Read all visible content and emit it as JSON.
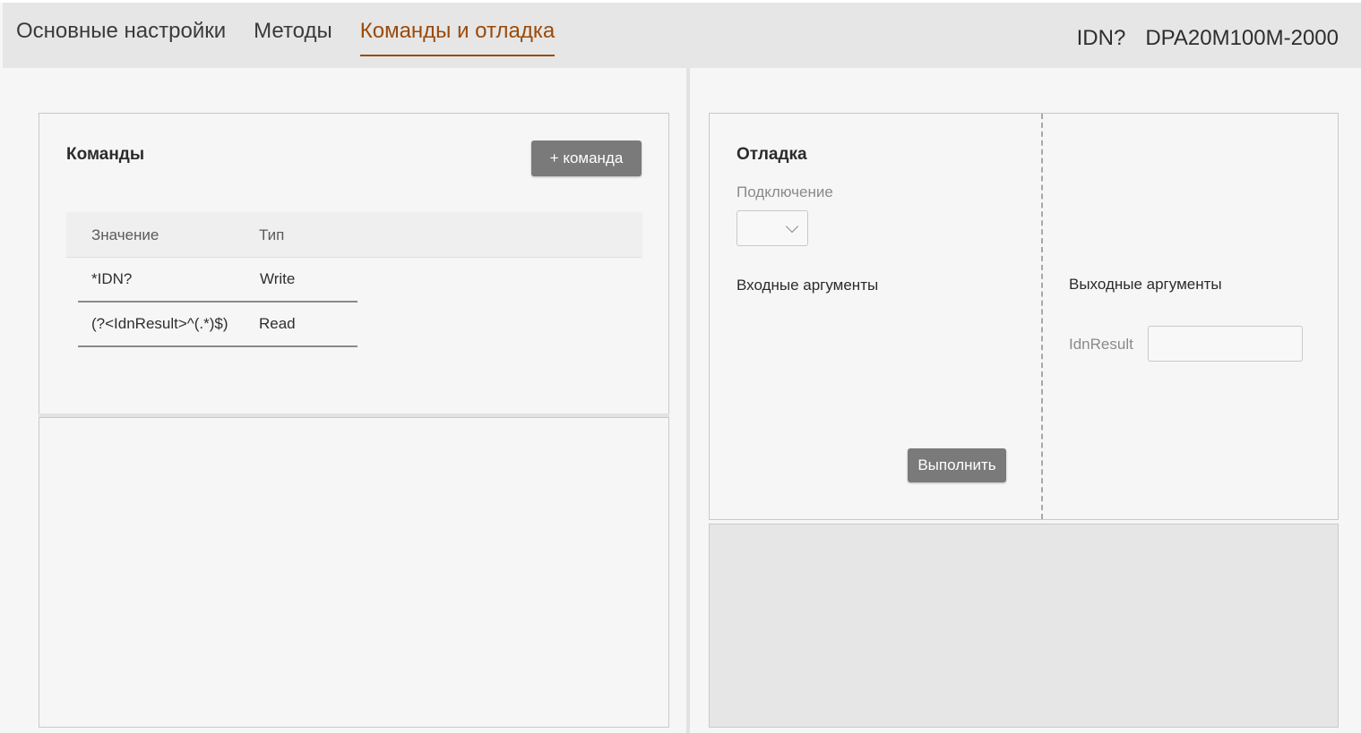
{
  "tabs": [
    {
      "label": "Основные настройки",
      "active": false
    },
    {
      "label": "Методы",
      "active": false
    },
    {
      "label": "Команды и отладка",
      "active": true
    }
  ],
  "device": {
    "idn_label": "IDN?",
    "model": "DPA20M100M-2000"
  },
  "commands": {
    "title": "Команды",
    "add_button": "+ команда",
    "columns": [
      "Значение",
      "Тип"
    ],
    "rows": [
      {
        "value": "*IDN?",
        "type": "Write"
      },
      {
        "value": "(?<IdnResult>^(.*)$)",
        "type": "Read"
      }
    ]
  },
  "debug": {
    "title": "Отладка",
    "connection_label": "Подключение",
    "connection_value": "",
    "input_args_label": "Входные аргументы",
    "output_args_label": "Выходные аргументы",
    "output_args": [
      {
        "name": "IdnResult",
        "value": ""
      }
    ],
    "run_button": "Выполнить"
  },
  "colors": {
    "accent": "#9a4a0b",
    "header_bg": "#e6e6e6",
    "button_bg": "#7a7a7a",
    "page_bg": "#f6f6f6"
  }
}
